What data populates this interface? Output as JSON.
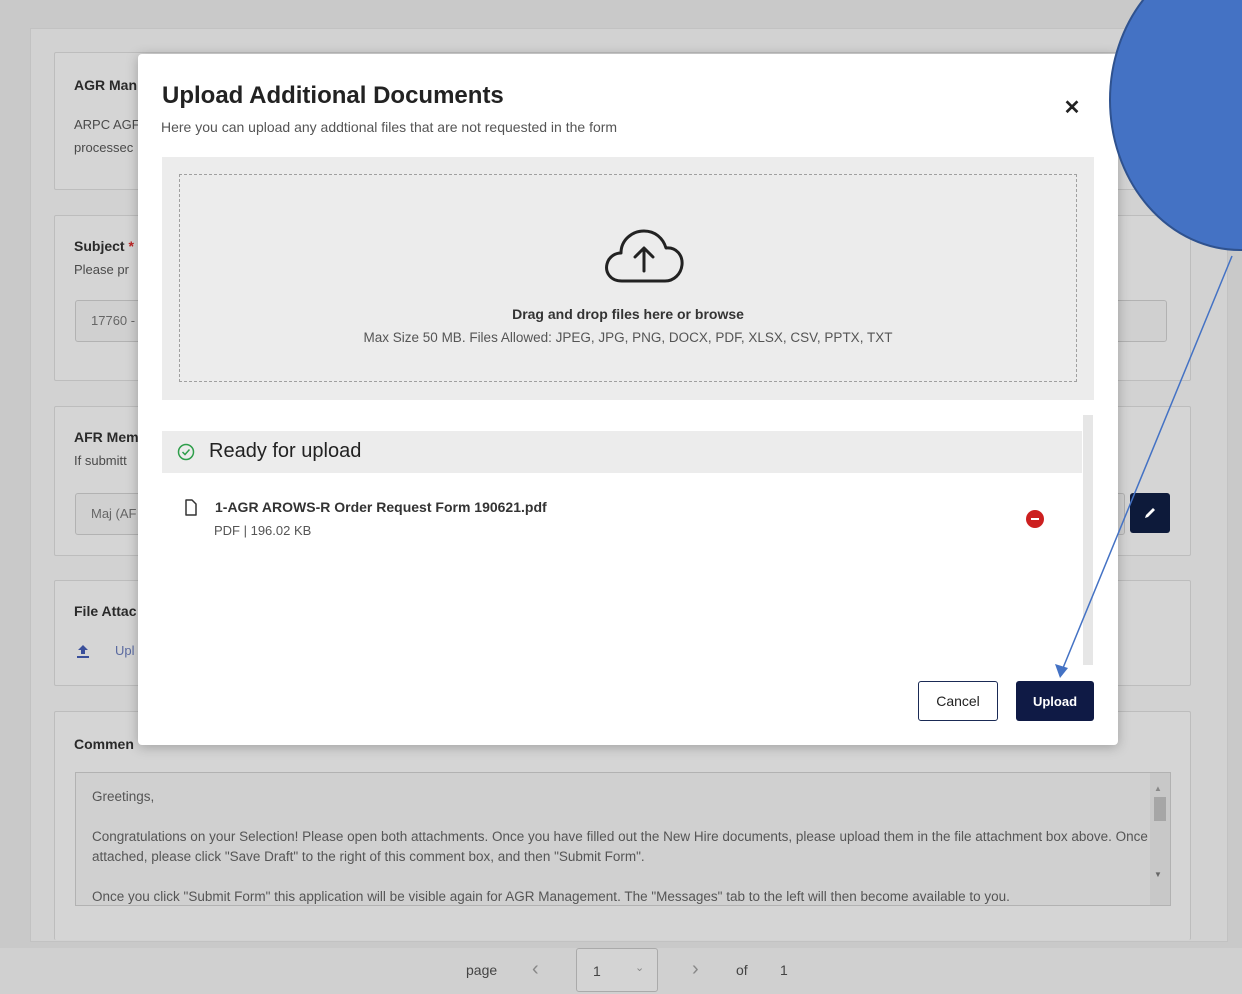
{
  "background": {
    "card1": {
      "title": "AGR Man",
      "line1": "ARPC AGF",
      "line2": "processec"
    },
    "card2": {
      "title": "Subject",
      "required_mark": "*",
      "text": "Please pr",
      "input_value": "17760 -"
    },
    "card3": {
      "title": "AFR Mem",
      "text": "If submitt",
      "input_value": "Maj (AF"
    },
    "card4": {
      "title": "File Attac",
      "upload_link": "Upl"
    },
    "comments": {
      "title": "Commen",
      "paragraphs": [
        "Greetings,",
        "Congratulations on your Selection! Please open both attachments. Once you have filled out the New Hire documents, please upload them in the file attachment box above. Once attached, please click \"Save Draft\" to the right of this comment box, and then \"Submit Form\".",
        "Once you click \"Submit Form\" this application will be visible again for AGR Management. The \"Messages\" tab to the left will then become available to you."
      ]
    }
  },
  "pager": {
    "page_label": "page",
    "current": "1",
    "of_label": "of",
    "total": "1"
  },
  "modal": {
    "title": "Upload Additional Documents",
    "subtitle": "Here you can upload any addtional files that are not requested in the form",
    "dropzone": {
      "title": "Drag and drop files here or browse",
      "hint": "Max Size 50 MB. Files Allowed: JPEG, JPG, PNG, DOCX, PDF, XLSX, CSV, PPTX, TXT"
    },
    "ready_label": "Ready for upload",
    "files": [
      {
        "name": "1-AGR AROWS-R Order Request Form 190621.pdf",
        "meta": "PDF | 196.02 KB"
      }
    ],
    "cancel_label": "Cancel",
    "upload_label": "Upload"
  },
  "colors": {
    "primary_navy": "#0f1a45",
    "danger": "#cc1f1f",
    "annotation_blue": "#4472c4",
    "success_green": "#2e9e4a"
  }
}
